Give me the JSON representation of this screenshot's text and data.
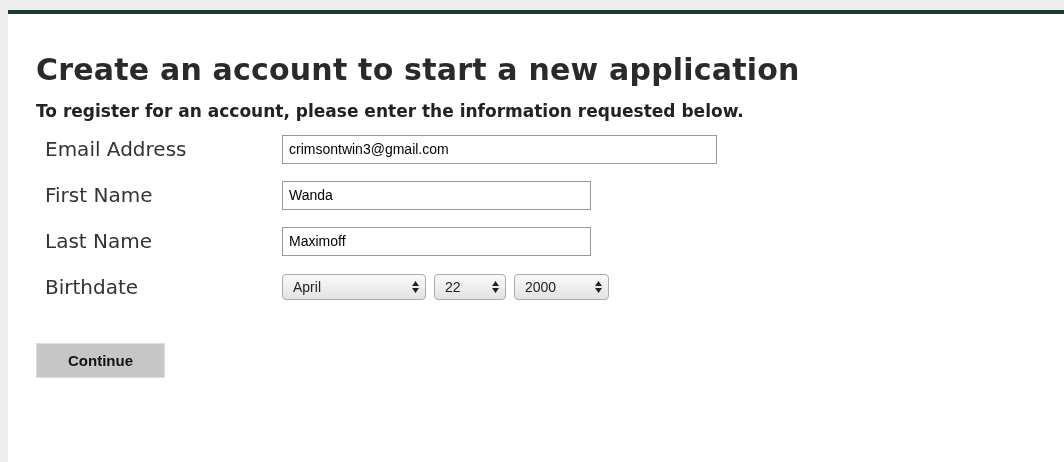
{
  "heading": "Create an account to start a new application",
  "subheading": "To register for an account, please enter the information requested below.",
  "fields": [
    {
      "label": "Email Address",
      "value": "crimsontwin3@gmail.com",
      "kind": "wide"
    },
    {
      "label": "First Name",
      "value": "Wanda",
      "kind": "text"
    },
    {
      "label": "Last Name",
      "value": "Maximoff",
      "kind": "text"
    }
  ],
  "birthdate": {
    "label": "Birthdate",
    "selects": [
      {
        "value": "April",
        "kind": "month"
      },
      {
        "value": "22",
        "kind": "day"
      },
      {
        "value": "2000",
        "kind": "year"
      }
    ]
  },
  "button": "Continue"
}
